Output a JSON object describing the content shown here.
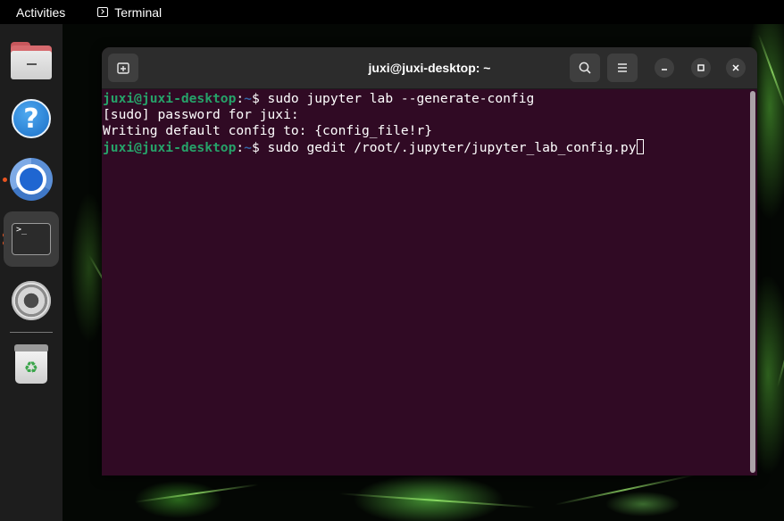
{
  "topbar": {
    "activities_label": "Activities",
    "app_label": "Terminal"
  },
  "dock": {
    "items": [
      {
        "name": "Files",
        "icon": "files-icon"
      },
      {
        "name": "Help",
        "icon": "help-icon"
      },
      {
        "name": "Chromium",
        "icon": "chromium-icon",
        "running": true
      },
      {
        "name": "Terminal",
        "icon": "terminal-icon",
        "running": true,
        "active": true
      },
      {
        "name": "Settings",
        "icon": "settings-icon"
      },
      {
        "name": "Trash",
        "icon": "trash-icon"
      }
    ]
  },
  "window": {
    "title": "juxi@juxi-desktop: ~"
  },
  "terminal": {
    "prompt_user": "juxi@juxi-desktop",
    "prompt_colon": ":",
    "prompt_path": "~",
    "prompt_symbol": "$ ",
    "line1_cmd": "sudo jupyter lab --generate-config",
    "line2": "[sudo] password for juxi:",
    "line3": "Writing default config to: {config_file!r}",
    "line4_cmd": "sudo gedit /root/.jupyter/jupyter_lab_config.py"
  },
  "colors": {
    "terminal_bg": "#300a24",
    "prompt_user": "#26a269",
    "prompt_path": "#3465a4",
    "accent": "#e95420"
  }
}
